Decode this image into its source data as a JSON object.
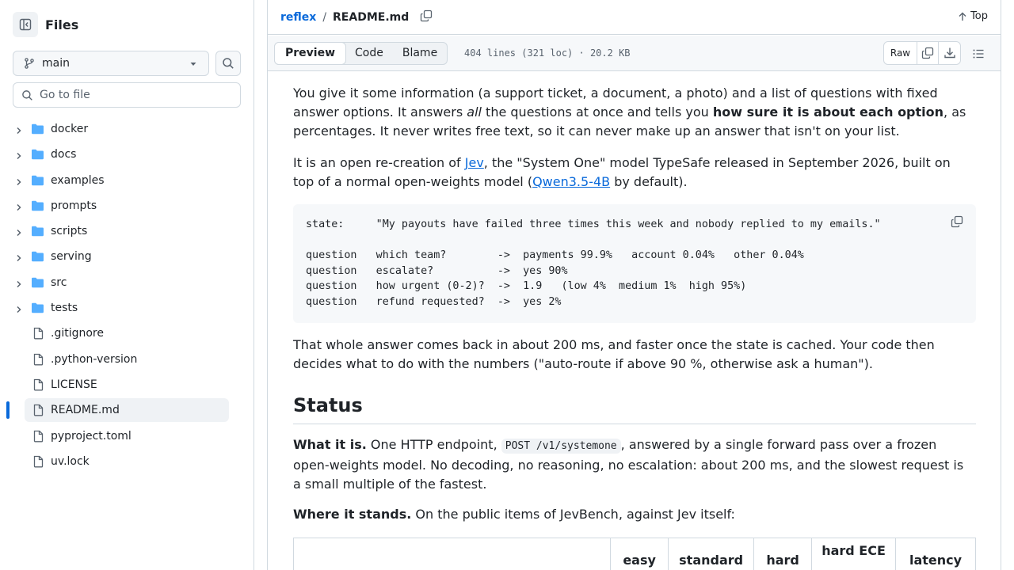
{
  "sidebar": {
    "title": "Files",
    "branch": "main",
    "goto_placeholder": "Go to file",
    "folders": [
      "docker",
      "docs",
      "examples",
      "prompts",
      "scripts",
      "serving",
      "src",
      "tests"
    ],
    "files": [
      ".gitignore",
      ".python-version",
      "LICENSE",
      "README.md",
      "pyproject.toml",
      "uv.lock"
    ],
    "selected": "README.md"
  },
  "header": {
    "repo": "reflex",
    "separator": "/",
    "file": "README.md",
    "top_label": "Top"
  },
  "filebar": {
    "tabs": [
      "Preview",
      "Code",
      "Blame"
    ],
    "active_tab": "Preview",
    "info": "404 lines (321 loc) · 20.2 KB",
    "raw_label": "Raw"
  },
  "readme": {
    "p1_a": "You give it some information (a support ticket, a document, a photo) and a list of questions with fixed answer options. It answers ",
    "p1_em": "all",
    "p1_b": " the questions at once and tells you ",
    "p1_strong": "how sure it is about each option",
    "p1_c": ", as percentages. It never writes free text, so it can never make up an answer that isn't on your list.",
    "p2_a": "It is an open re-creation of ",
    "p2_link1": "Jev",
    "p2_b": ", the \"System One\" model TypeSafe released in September 2026, built on top of a normal open-weights model (",
    "p2_link2": "Qwen3.5-4B",
    "p2_c": " by default).",
    "code": "state:     \"My payouts have failed three times this week and nobody replied to my emails.\"\n\nquestion   which team?        ->  payments 99.9%   account 0.04%   other 0.04%\nquestion   escalate?          ->  yes 90%\nquestion   how urgent (0-2)?  ->  1.9   (low 4%  medium 1%  high 95%)\nquestion   refund requested?  ->  yes 2%",
    "p3": "That whole answer comes back in about 200 ms, and faster once the state is cached. Your code then decides what to do with the numbers (\"auto-route if above 90 %, otherwise ask a human\").",
    "h2": "Status",
    "p4_strong": "What it is.",
    "p4_a": " One HTTP endpoint, ",
    "p4_code": "POST /v1/systemone",
    "p4_b": ", answered by a single forward pass over a frozen open-weights model. No decoding, no reasoning, no escalation: about 200 ms, and the slowest request is a small multiple of the fastest.",
    "p5_strong": "Where it stands.",
    "p5_a": " On the public items of JevBench, against Jev itself:",
    "table_headers": [
      "",
      "easy",
      "standard",
      "hard",
      "hard ECE",
      "latency"
    ]
  }
}
